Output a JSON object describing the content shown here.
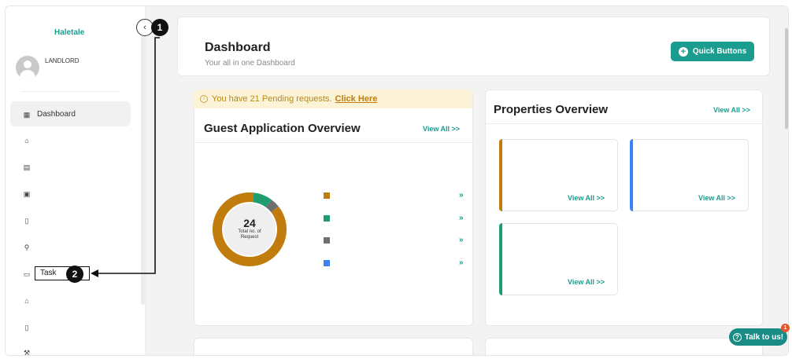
{
  "brand": "Haletale",
  "user": {
    "role": "LANDLORD"
  },
  "sidebar": {
    "items": [
      {
        "label": "Dashboard",
        "icon": "dashboard-icon",
        "glyph": "▦"
      },
      {
        "label": "",
        "icon": "home-icon",
        "glyph": "⌂"
      },
      {
        "label": "",
        "icon": "clipboard-icon",
        "glyph": "▤"
      },
      {
        "label": "",
        "icon": "contacts-icon",
        "glyph": "▣"
      },
      {
        "label": "",
        "icon": "document-icon",
        "glyph": "▯"
      },
      {
        "label": "",
        "icon": "wrench-icon",
        "glyph": "⚲"
      },
      {
        "label": "Task",
        "icon": "task-icon",
        "glyph": "▭"
      },
      {
        "label": "",
        "icon": "building-icon",
        "glyph": "⌂"
      },
      {
        "label": "",
        "icon": "files-icon",
        "glyph": "▯"
      },
      {
        "label": "",
        "icon": "tools-icon",
        "glyph": "⚒"
      }
    ]
  },
  "annotations": {
    "one": "1",
    "two": "2"
  },
  "header": {
    "title": "Dashboard",
    "subtitle": "Your all in one Dashboard",
    "quick_buttons": "Quick Buttons"
  },
  "pending": {
    "text": "You have 21 Pending requests.",
    "link": "Click Here"
  },
  "guest": {
    "title": "Guest Application Overview",
    "view_all": "View All >>",
    "total": "24",
    "total_label_1": "Total no. of",
    "total_label_2": "Request",
    "legend": [
      {
        "color": "#c07d0e",
        "arrow": "»"
      },
      {
        "color": "#1e9e6e",
        "arrow": "»"
      },
      {
        "color": "#6f6f6f",
        "arrow": "»"
      },
      {
        "color": "#3b82f6",
        "arrow": "»"
      }
    ],
    "segments": [
      {
        "color": "#c07d0e",
        "fraction": 0.875
      },
      {
        "color": "#1e9e6e",
        "fraction": 0.083
      },
      {
        "color": "#6f6f6f",
        "fraction": 0.042
      }
    ]
  },
  "properties": {
    "title": "Properties Overview",
    "view_all": "View All >>",
    "cards": [
      {
        "accent": "#c07d0e",
        "view_all": "View All >>"
      },
      {
        "accent": "#3b82f6",
        "view_all": "View All >>"
      },
      {
        "accent": "#1e9e6e",
        "view_all": "View All >>"
      }
    ]
  },
  "talk": {
    "label": "Talk to us!",
    "badge": "1"
  }
}
